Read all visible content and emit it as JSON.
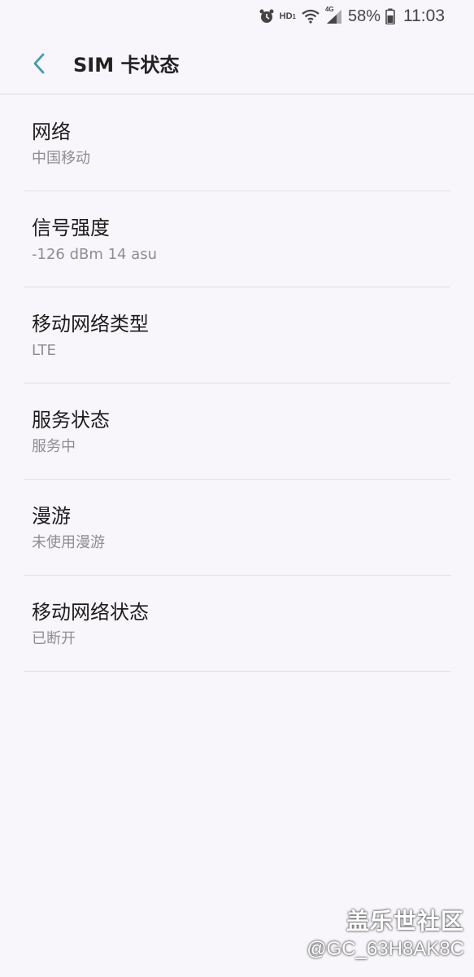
{
  "status_bar": {
    "icons": [
      "alarm-icon",
      "hd-voice-icon",
      "wifi-icon",
      "signal-4g-icon",
      "battery-icon"
    ],
    "hd_label": "HD",
    "network_label": "4G",
    "battery_percent": "58%",
    "time": "11:03"
  },
  "app_bar": {
    "back_icon": "chevron-left-icon",
    "title": "SIM 卡状态"
  },
  "items": [
    {
      "title": "网络",
      "value": "中国移动"
    },
    {
      "title": "信号强度",
      "value": "-126 dBm 14 asu"
    },
    {
      "title": "移动网络类型",
      "value": "LTE"
    },
    {
      "title": "服务状态",
      "value": "服务中"
    },
    {
      "title": "漫游",
      "value": "未使用漫游"
    },
    {
      "title": "移动网络状态",
      "value": "已断开"
    }
  ],
  "watermark": {
    "brand": "盖乐世社区",
    "user": "@GC_63H8AK8C"
  },
  "colors": {
    "accent": "#4a9bb5",
    "background": "#f8f6fb",
    "divider": "#e2e0e6",
    "secondary_text": "#8e8e8e"
  }
}
